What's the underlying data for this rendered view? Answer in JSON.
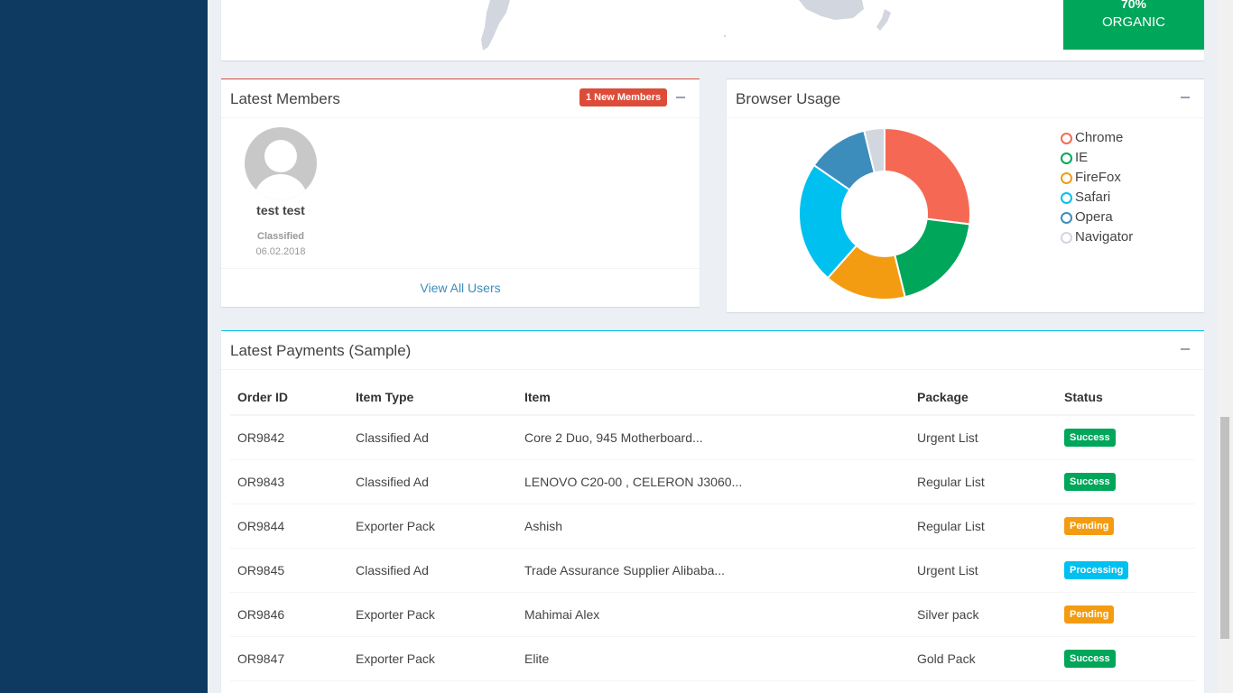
{
  "organic": {
    "percent": "70%",
    "label": "ORGANIC"
  },
  "members": {
    "title": "Latest Members",
    "badge": "1 New Members",
    "list": [
      {
        "name": "test test",
        "role": "Classified",
        "date": "06.02.2018"
      }
    ],
    "view_all": "View All Users"
  },
  "browser": {
    "title": "Browser Usage",
    "legend": [
      {
        "label": "Chrome",
        "color": "#f56954"
      },
      {
        "label": "IE",
        "color": "#00a65a"
      },
      {
        "label": "FireFox",
        "color": "#f39c12"
      },
      {
        "label": "Safari",
        "color": "#00c0ef"
      },
      {
        "label": "Opera",
        "color": "#3c8dbc"
      },
      {
        "label": "Navigator",
        "color": "#d2d6de"
      }
    ]
  },
  "chart_data": {
    "type": "pie",
    "categories": [
      "Chrome",
      "IE",
      "FireFox",
      "Safari",
      "Opera",
      "Navigator"
    ],
    "values": [
      700,
      500,
      400,
      600,
      300,
      100
    ],
    "colors": [
      "#f56954",
      "#00a65a",
      "#f39c12",
      "#00c0ef",
      "#3c8dbc",
      "#d2d6de"
    ]
  },
  "payments": {
    "title": "Latest Payments (Sample)",
    "headers": [
      "Order ID",
      "Item Type",
      "Item",
      "Package",
      "Status"
    ],
    "rows": [
      {
        "id": "OR9842",
        "type": "Classified Ad",
        "item": "Core 2 Duo, 945 Motherboard...",
        "package": "Urgent List",
        "status": "Success"
      },
      {
        "id": "OR9843",
        "type": "Classified Ad",
        "item": "LENOVO C20-00 , CELERON J3060...",
        "package": "Regular List",
        "status": "Success"
      },
      {
        "id": "OR9844",
        "type": "Exporter Pack",
        "item": "Ashish",
        "package": "Regular List",
        "status": "Pending"
      },
      {
        "id": "OR9845",
        "type": "Classified Ad",
        "item": "Trade Assurance Supplier Alibaba...",
        "package": "Urgent List",
        "status": "Processing"
      },
      {
        "id": "OR9846",
        "type": "Exporter Pack",
        "item": "Mahimai Alex",
        "package": "Silver pack",
        "status": "Pending"
      },
      {
        "id": "OR9847",
        "type": "Exporter Pack",
        "item": "Elite",
        "package": "Gold Pack",
        "status": "Success"
      }
    ]
  }
}
